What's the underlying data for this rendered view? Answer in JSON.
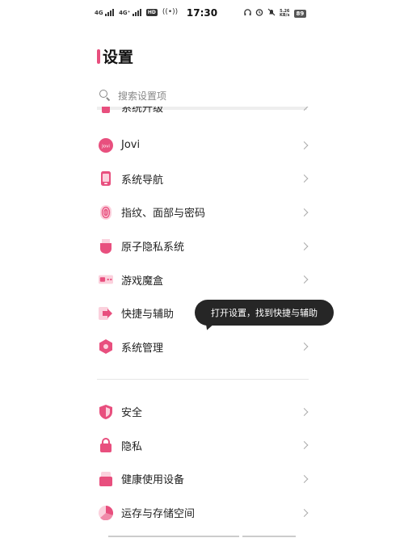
{
  "status_bar": {
    "sim1": "4G",
    "sim2": "4G⁺",
    "hd": "HD",
    "wifi": "((•))",
    "time": "17:30",
    "speed_value": "5.26",
    "speed_unit": "KB/s",
    "battery": "89"
  },
  "page": {
    "title": "设置"
  },
  "search": {
    "placeholder": "搜索设置项"
  },
  "partial_item": {
    "label": "系统升级",
    "icon": "system-update-icon"
  },
  "group1": [
    {
      "label": "Jovi",
      "icon": "jovi-icon",
      "icon_text": "Jovi"
    },
    {
      "label": "系统导航",
      "icon": "system-navigation-icon"
    },
    {
      "label": "指纹、面部与密码",
      "icon": "fingerprint-icon"
    },
    {
      "label": "原子隐私系统",
      "icon": "atomic-privacy-icon"
    },
    {
      "label": "游戏魔盒",
      "icon": "game-box-icon"
    },
    {
      "label": "快捷与辅助",
      "icon": "shortcuts-accessibility-icon"
    },
    {
      "label": "系统管理",
      "icon": "system-management-icon"
    }
  ],
  "group2": [
    {
      "label": "安全",
      "icon": "security-shield-icon"
    },
    {
      "label": "隐私",
      "icon": "privacy-lock-icon"
    },
    {
      "label": "健康使用设备",
      "icon": "healthy-device-usage-icon"
    },
    {
      "label": "运存与存储空间",
      "icon": "ram-storage-icon"
    }
  ],
  "tooltip": {
    "text": "打开设置，找到快捷与辅助"
  },
  "colors": {
    "accent": "#e84f7e",
    "icon_light": "#fbd1dd",
    "tooltip_bg": "#262626"
  }
}
